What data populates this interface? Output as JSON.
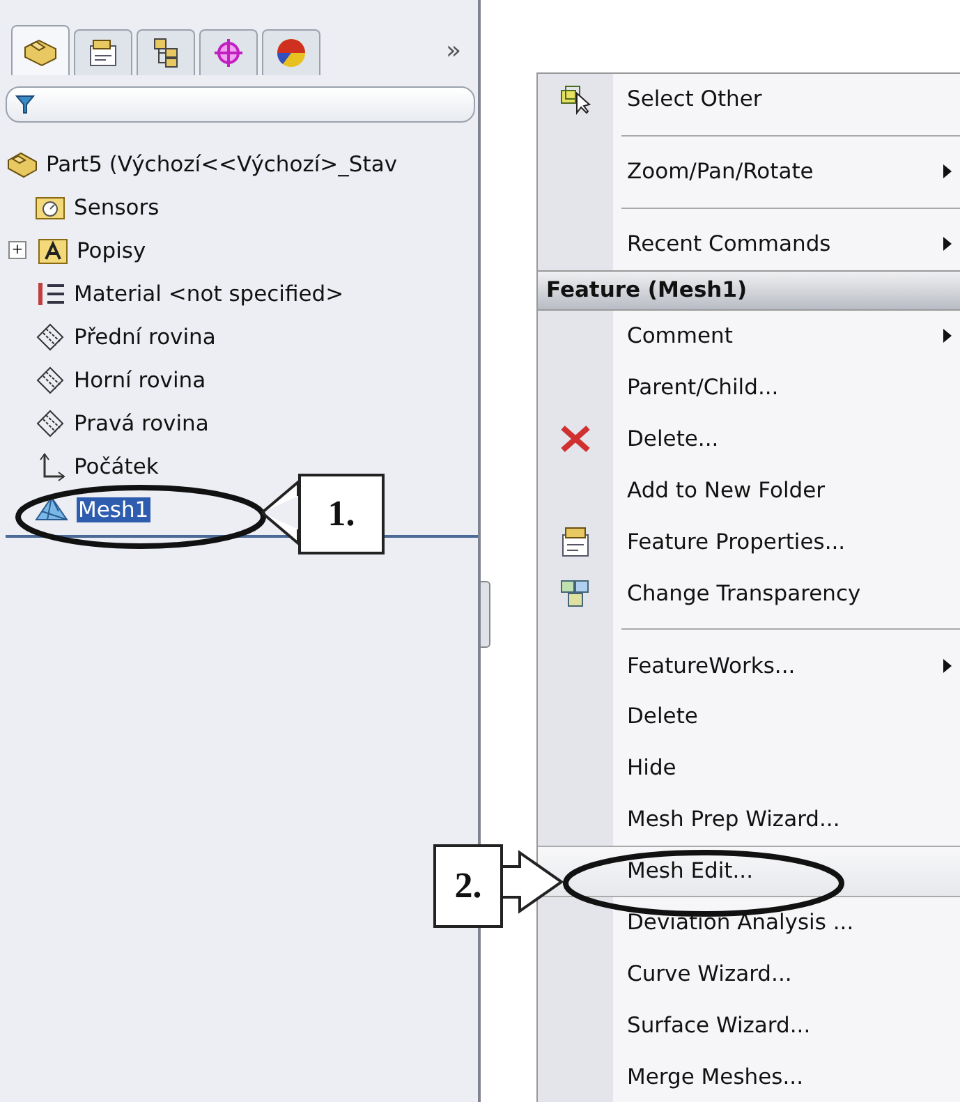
{
  "panel": {
    "tabs": [
      {
        "kind": "part",
        "selected": true
      },
      {
        "kind": "properties",
        "selected": false
      },
      {
        "kind": "config",
        "selected": false
      },
      {
        "kind": "target",
        "selected": false
      },
      {
        "kind": "appearance",
        "selected": false
      }
    ],
    "more": "»",
    "tree": {
      "label": "Part5  (Výchozí<<Výchozí>_Stav",
      "kind": "part",
      "selected": false,
      "children": [
        {
          "label": "Sensors",
          "kind": "sensors",
          "selected": false
        },
        {
          "label": "Popisy",
          "kind": "annotations",
          "selected": false,
          "toggle": "+"
        },
        {
          "label": "Material <not specified>",
          "kind": "material",
          "selected": false
        },
        {
          "label": "Přední rovina",
          "kind": "plane",
          "selected": false
        },
        {
          "label": "Horní rovina",
          "kind": "plane",
          "selected": false
        },
        {
          "label": "Pravá rovina",
          "kind": "plane",
          "selected": false
        },
        {
          "label": "Počátek",
          "kind": "origin",
          "selected": false
        },
        {
          "label": "Mesh1",
          "kind": "mesh",
          "selected": true
        }
      ]
    }
  },
  "menu": [
    {
      "kind": "item",
      "label": "Select Other",
      "submenu": false,
      "selected": false
    },
    {
      "kind": "separator"
    },
    {
      "kind": "item",
      "label": "Zoom/Pan/Rotate",
      "submenu": true,
      "selected": false
    },
    {
      "kind": "separator"
    },
    {
      "kind": "item",
      "label": "Recent Commands",
      "submenu": true,
      "selected": false
    },
    {
      "kind": "header",
      "label": "Feature (Mesh1)"
    },
    {
      "kind": "item",
      "label": "Comment",
      "submenu": true,
      "selected": false
    },
    {
      "kind": "item",
      "label": "Parent/Child...",
      "submenu": false,
      "selected": false
    },
    {
      "kind": "item",
      "label": "Delete...",
      "submenu": false,
      "selected": false
    },
    {
      "kind": "item",
      "label": "Add to New Folder",
      "submenu": false,
      "selected": false
    },
    {
      "kind": "item",
      "label": "Feature Properties...",
      "submenu": false,
      "selected": false
    },
    {
      "kind": "item",
      "label": "Change Transparency",
      "submenu": false,
      "selected": false
    },
    {
      "kind": "separator"
    },
    {
      "kind": "item",
      "label": "FeatureWorks...",
      "submenu": true,
      "selected": false
    },
    {
      "kind": "item",
      "label": "Delete",
      "submenu": false,
      "selected": false
    },
    {
      "kind": "item",
      "label": "Hide",
      "submenu": false,
      "selected": false
    },
    {
      "kind": "item",
      "label": "Mesh Prep Wizard...",
      "submenu": false,
      "selected": false
    },
    {
      "kind": "item",
      "label": "Mesh Edit...",
      "submenu": false,
      "selected": true
    },
    {
      "kind": "item",
      "label": "Deviation Analysis ...",
      "submenu": false,
      "selected": false
    },
    {
      "kind": "item",
      "label": "Curve Wizard...",
      "submenu": false,
      "selected": false
    },
    {
      "kind": "item",
      "label": "Surface Wizard...",
      "submenu": false,
      "selected": false
    },
    {
      "kind": "item",
      "label": "Merge Meshes...",
      "submenu": false,
      "selected": false
    }
  ],
  "callouts": [
    {
      "label": "1."
    },
    {
      "label": "2."
    }
  ]
}
